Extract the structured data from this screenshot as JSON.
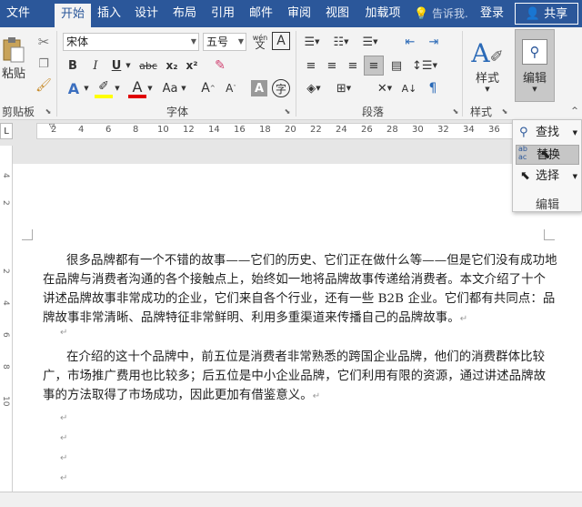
{
  "menubar": {
    "tabs": [
      "文件",
      "开始",
      "插入",
      "设计",
      "布局",
      "引用",
      "邮件",
      "审阅",
      "视图",
      "加载项"
    ],
    "active": "开始",
    "tell_me": "告诉我.",
    "sign_in": "登录",
    "share": "共享"
  },
  "clipboard": {
    "paste": "粘贴",
    "label": "剪贴板"
  },
  "font": {
    "name": "宋体",
    "size": "五号",
    "label": "字体",
    "wen": "wén",
    "a_box": "A",
    "bold": "B",
    "italic": "I",
    "underline": "U",
    "strike": "abc",
    "sub": "x₂",
    "sup": "x²",
    "aa": "Aa"
  },
  "paragraph": {
    "label": "段落"
  },
  "styles": {
    "label": "样式",
    "btn": "样式"
  },
  "editing": {
    "btn": "编辑"
  },
  "ruler": {
    "numbers": [
      "2",
      "4",
      "6",
      "8",
      "10",
      "12",
      "14",
      "16",
      "18",
      "20",
      "22",
      "24",
      "26",
      "28",
      "30",
      "32",
      "34",
      "36"
    ]
  },
  "vruler": {
    "numbers": [
      "4",
      "2",
      "2",
      "4",
      "6",
      "8",
      "10"
    ]
  },
  "doc": {
    "para1": "很多品牌都有一个不错的故事——它们的历史、它们正在做什么等——但是它们没有成功地在品牌与消费者沟通的各个接触点上，始终如一地将品牌故事传递给消费者。本文介绍了十个讲述品牌故事非常成功的企业，它们来自各个行业，还有一些 B2B 企业。它们都有共同点：品牌故事非常清晰、品牌特征非常鲜明、利用多重渠道来传播自己的品牌故事。",
    "para2": "在介绍的这十个品牌中，前五位是消费者非常熟悉的跨国企业品牌，他们的消费群体比较广，市场推广费用也比较多；后五位是中小企业品牌，它们利用有限的资源，通过讲述品牌故事的方法取得了市场成功，因此更加有借鉴意义。",
    "return_mark": "↵"
  },
  "dropdown": {
    "find": "查找",
    "replace": "替换",
    "select": "选择",
    "label": "编辑"
  },
  "colors": {
    "accent": "#2b579a",
    "highlight": "#ffff00",
    "font_red": "#e00000"
  }
}
